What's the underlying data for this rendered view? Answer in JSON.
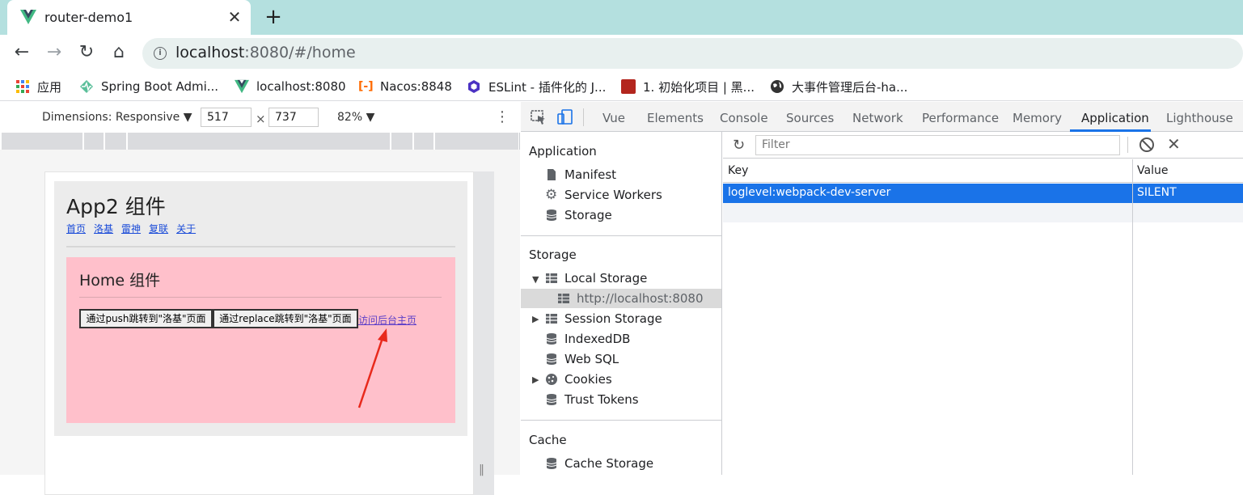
{
  "browser": {
    "tab_title": "router-demo1",
    "url_host": "localhost",
    "url_rest": ":8080/#/home",
    "accent_color": "#b4e0df"
  },
  "bookmarks": [
    {
      "label": "应用",
      "icon": "apps-grid-icon"
    },
    {
      "label": "Spring Boot Admi...",
      "icon": "spring-boot-admin-icon"
    },
    {
      "label": "localhost:8080",
      "icon": "vue-logo-icon"
    },
    {
      "label": "Nacos:8848",
      "icon": "alibaba-cloud-icon"
    },
    {
      "label": "ESLint - 插件化的 J...",
      "icon": "eslint-icon"
    },
    {
      "label": "1. 初始化项目 | 黑...",
      "icon": "red-site-icon"
    },
    {
      "label": "大事件管理后台-ha...",
      "icon": "globe-icon"
    }
  ],
  "device_toolbar": {
    "dimensions_label": "Dimensions: Responsive ▼",
    "width": "517",
    "height": "737",
    "times": "×",
    "zoom": "82% ▼"
  },
  "app": {
    "title": "App2 组件",
    "nav_links": [
      "首页",
      "洛基",
      "雷神",
      "复联",
      "关于"
    ],
    "home_title": "Home 组件",
    "push_button": "通过push跳转到\"洛基\"页面",
    "replace_button": "通过replace跳转到\"洛基\"页面",
    "admin_link": "访问后台主页"
  },
  "devtools": {
    "tabs": [
      "Vue",
      "Elements",
      "Console",
      "Sources",
      "Network",
      "Performance",
      "Memory",
      "Application",
      "Lighthouse"
    ],
    "active_tab": "Application",
    "sidebar": {
      "application_header": "Application",
      "manifest": "Manifest",
      "service_workers": "Service Workers",
      "storage_item": "Storage",
      "storage_header": "Storage",
      "local_storage": "Local Storage",
      "local_origin": "http://localhost:8080",
      "session_storage": "Session Storage",
      "indexeddb": "IndexedDB",
      "websql": "Web SQL",
      "cookies": "Cookies",
      "trust_tokens": "Trust Tokens",
      "cache_header": "Cache",
      "cache_storage": "Cache Storage"
    },
    "filter_placeholder": "Filter",
    "columns": {
      "key": "Key",
      "value": "Value"
    },
    "rows": [
      {
        "key": "loglevel:webpack-dev-server",
        "value": "SILENT"
      }
    ],
    "selection_color": "#1a73e8"
  }
}
